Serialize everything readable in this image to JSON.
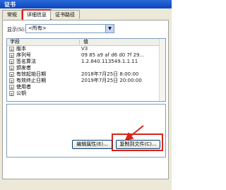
{
  "window": {
    "title": "证书"
  },
  "tabs": [
    {
      "label": "常规"
    },
    {
      "label": "详细信息"
    },
    {
      "label": "证书路径"
    }
  ],
  "filter": {
    "label": "显示(S):",
    "value": "<所有>"
  },
  "columns": {
    "field": "字段",
    "value": "值"
  },
  "rows": [
    {
      "field": "版本",
      "value": "V3"
    },
    {
      "field": "序列号",
      "value": "09 85 a9 af d6 d0 7f 29..."
    },
    {
      "field": "签名算法",
      "value": "1.2.840.113549.1.1.11"
    },
    {
      "field": "颁发者",
      "value": ""
    },
    {
      "field": "有效起始日期",
      "value": "2018年7月25日 8:00:00"
    },
    {
      "field": "有效终止日期",
      "value": "2019年7月25日 20:00:00"
    },
    {
      "field": "使用者",
      "value": ""
    },
    {
      "field": "公钥",
      "value": ""
    }
  ],
  "buttons": {
    "edit_properties": "编辑属性(E)...",
    "copy_to_file": "复制到文件(C)..."
  },
  "colors": {
    "highlight": "#d9231a",
    "titlebar": "#0a46c0"
  }
}
